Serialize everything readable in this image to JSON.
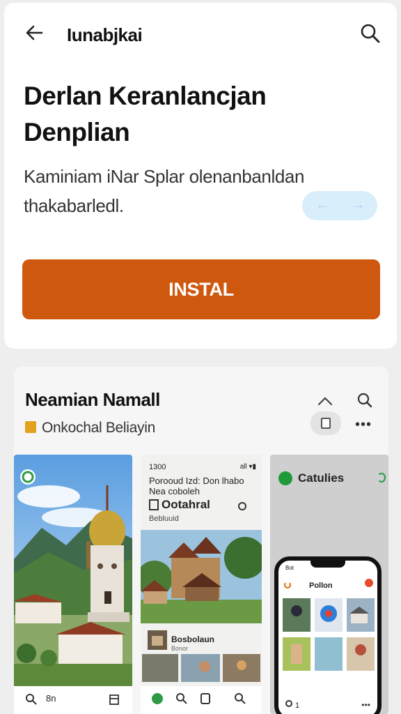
{
  "appbar": {
    "title": "Iunabjkai"
  },
  "app": {
    "title": "Derlan Keranlancjan Denplian",
    "description": "Kaminiam iNar Splar olenanbanldan thakabarledl.",
    "install_label": "INSTAL",
    "pager_prev": "←",
    "pager_next": "→"
  },
  "section": {
    "title": "Neamian Namall",
    "subtitle": "Onkochal Beliayin",
    "more": "•••"
  },
  "screenshots": [
    {
      "nav_label": "8n"
    },
    {
      "status_time": "1300",
      "status_icons": "all ▾▮",
      "header": "Porooud Izd: Don lhabo Nea coboleh",
      "heading": "Ootahral",
      "caption": "Bebluuid",
      "item_name": "Bosbolaun",
      "item_meta": "Bonor"
    },
    {
      "title": "Catulies",
      "phone": {
        "time": "Bot",
        "title": "Pollon",
        "count": "1",
        "more": "•••"
      }
    }
  ],
  "colors": {
    "accent": "#cf580f",
    "pager": "#d9eefb",
    "brand_green": "#1f9a3a"
  }
}
